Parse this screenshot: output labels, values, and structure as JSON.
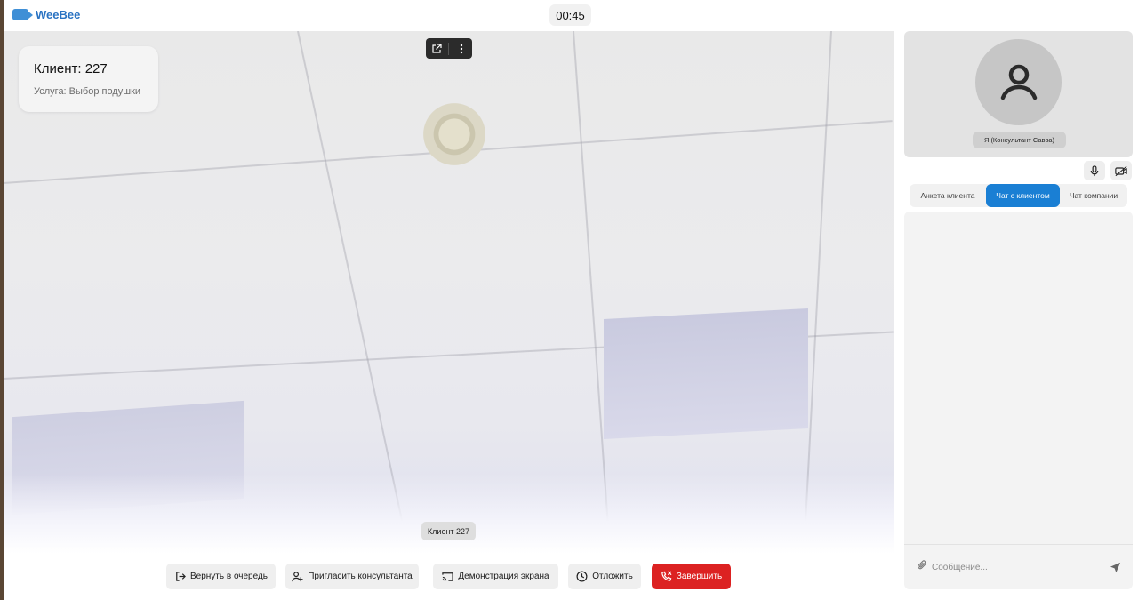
{
  "header": {
    "logo_text": "WeeBee",
    "timer": "00:45"
  },
  "video": {
    "client_title": "Клиент: 227",
    "client_service": "Услуга: Выбор подушки",
    "participant_label": "Клиент 227",
    "controls": {
      "open_icon": "external-link-icon",
      "more_icon": "more-vertical-icon"
    }
  },
  "toolbar": {
    "return_queue": "Вернуть в очередь",
    "invite_consultant": "Пригласить консультанта",
    "screen_share": "Демонстрация экрана",
    "postpone": "Отложить",
    "finish": "Завершить"
  },
  "self_view": {
    "name": "Я (Консультант Савва)"
  },
  "tabs": [
    {
      "label": "Анкета клиента",
      "active": false
    },
    {
      "label": "Чат с клиентом",
      "active": true
    },
    {
      "label": "Чат компании",
      "active": false
    }
  ],
  "chat": {
    "input_placeholder": "Сообщение..."
  },
  "colors": {
    "accent": "#1a7fd4",
    "danger": "#dc2222",
    "logo": "#2a73c2"
  }
}
